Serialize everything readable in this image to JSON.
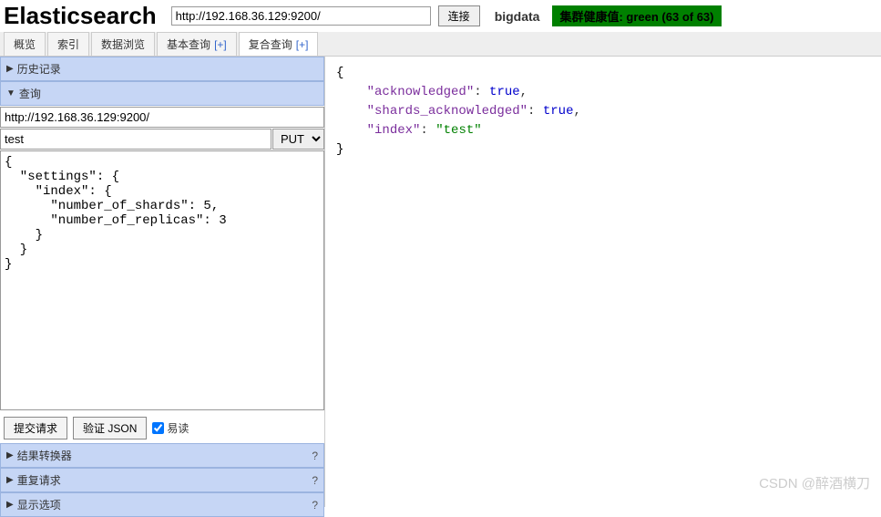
{
  "header": {
    "logo": "Elasticsearch",
    "url": "http://192.168.36.129:9200/",
    "connect_label": "连接",
    "cluster_name": "bigdata",
    "health_text": "集群健康值: green (63 of 63)"
  },
  "tabs": {
    "overview": "概览",
    "indices": "索引",
    "browse": "数据浏览",
    "basic_query": "基本查询",
    "basic_query_plus": "[+]",
    "complex_query": "复合查询",
    "complex_query_plus": "[+]"
  },
  "sections": {
    "history": "历史记录",
    "query": "查询",
    "result_transformer": "结果转换器",
    "repeat_request": "重复请求",
    "display_options": "显示选项"
  },
  "query": {
    "url": "http://192.168.36.129:9200/",
    "path": "test",
    "method": "PUT",
    "body": "{\n  \"settings\": {\n    \"index\": {\n      \"number_of_shards\": 5,\n      \"number_of_replicas\": 3\n    }\n  }\n}"
  },
  "actions": {
    "submit": "提交请求",
    "validate": "验证 JSON",
    "readable": "易读"
  },
  "response": {
    "lines": [
      {
        "indent": 0,
        "text": "{"
      },
      {
        "indent": 1,
        "key": "\"acknowledged\"",
        "colon": ": ",
        "value": "true",
        "comma": ","
      },
      {
        "indent": 1,
        "key": "\"shards_acknowledged\"",
        "colon": ": ",
        "value": "true",
        "comma": ","
      },
      {
        "indent": 1,
        "key": "\"index\"",
        "colon": ": ",
        "string": "\"test\"",
        "comma": ""
      },
      {
        "indent": 0,
        "text": "}"
      }
    ]
  },
  "watermark": "CSDN @醉酒横刀"
}
